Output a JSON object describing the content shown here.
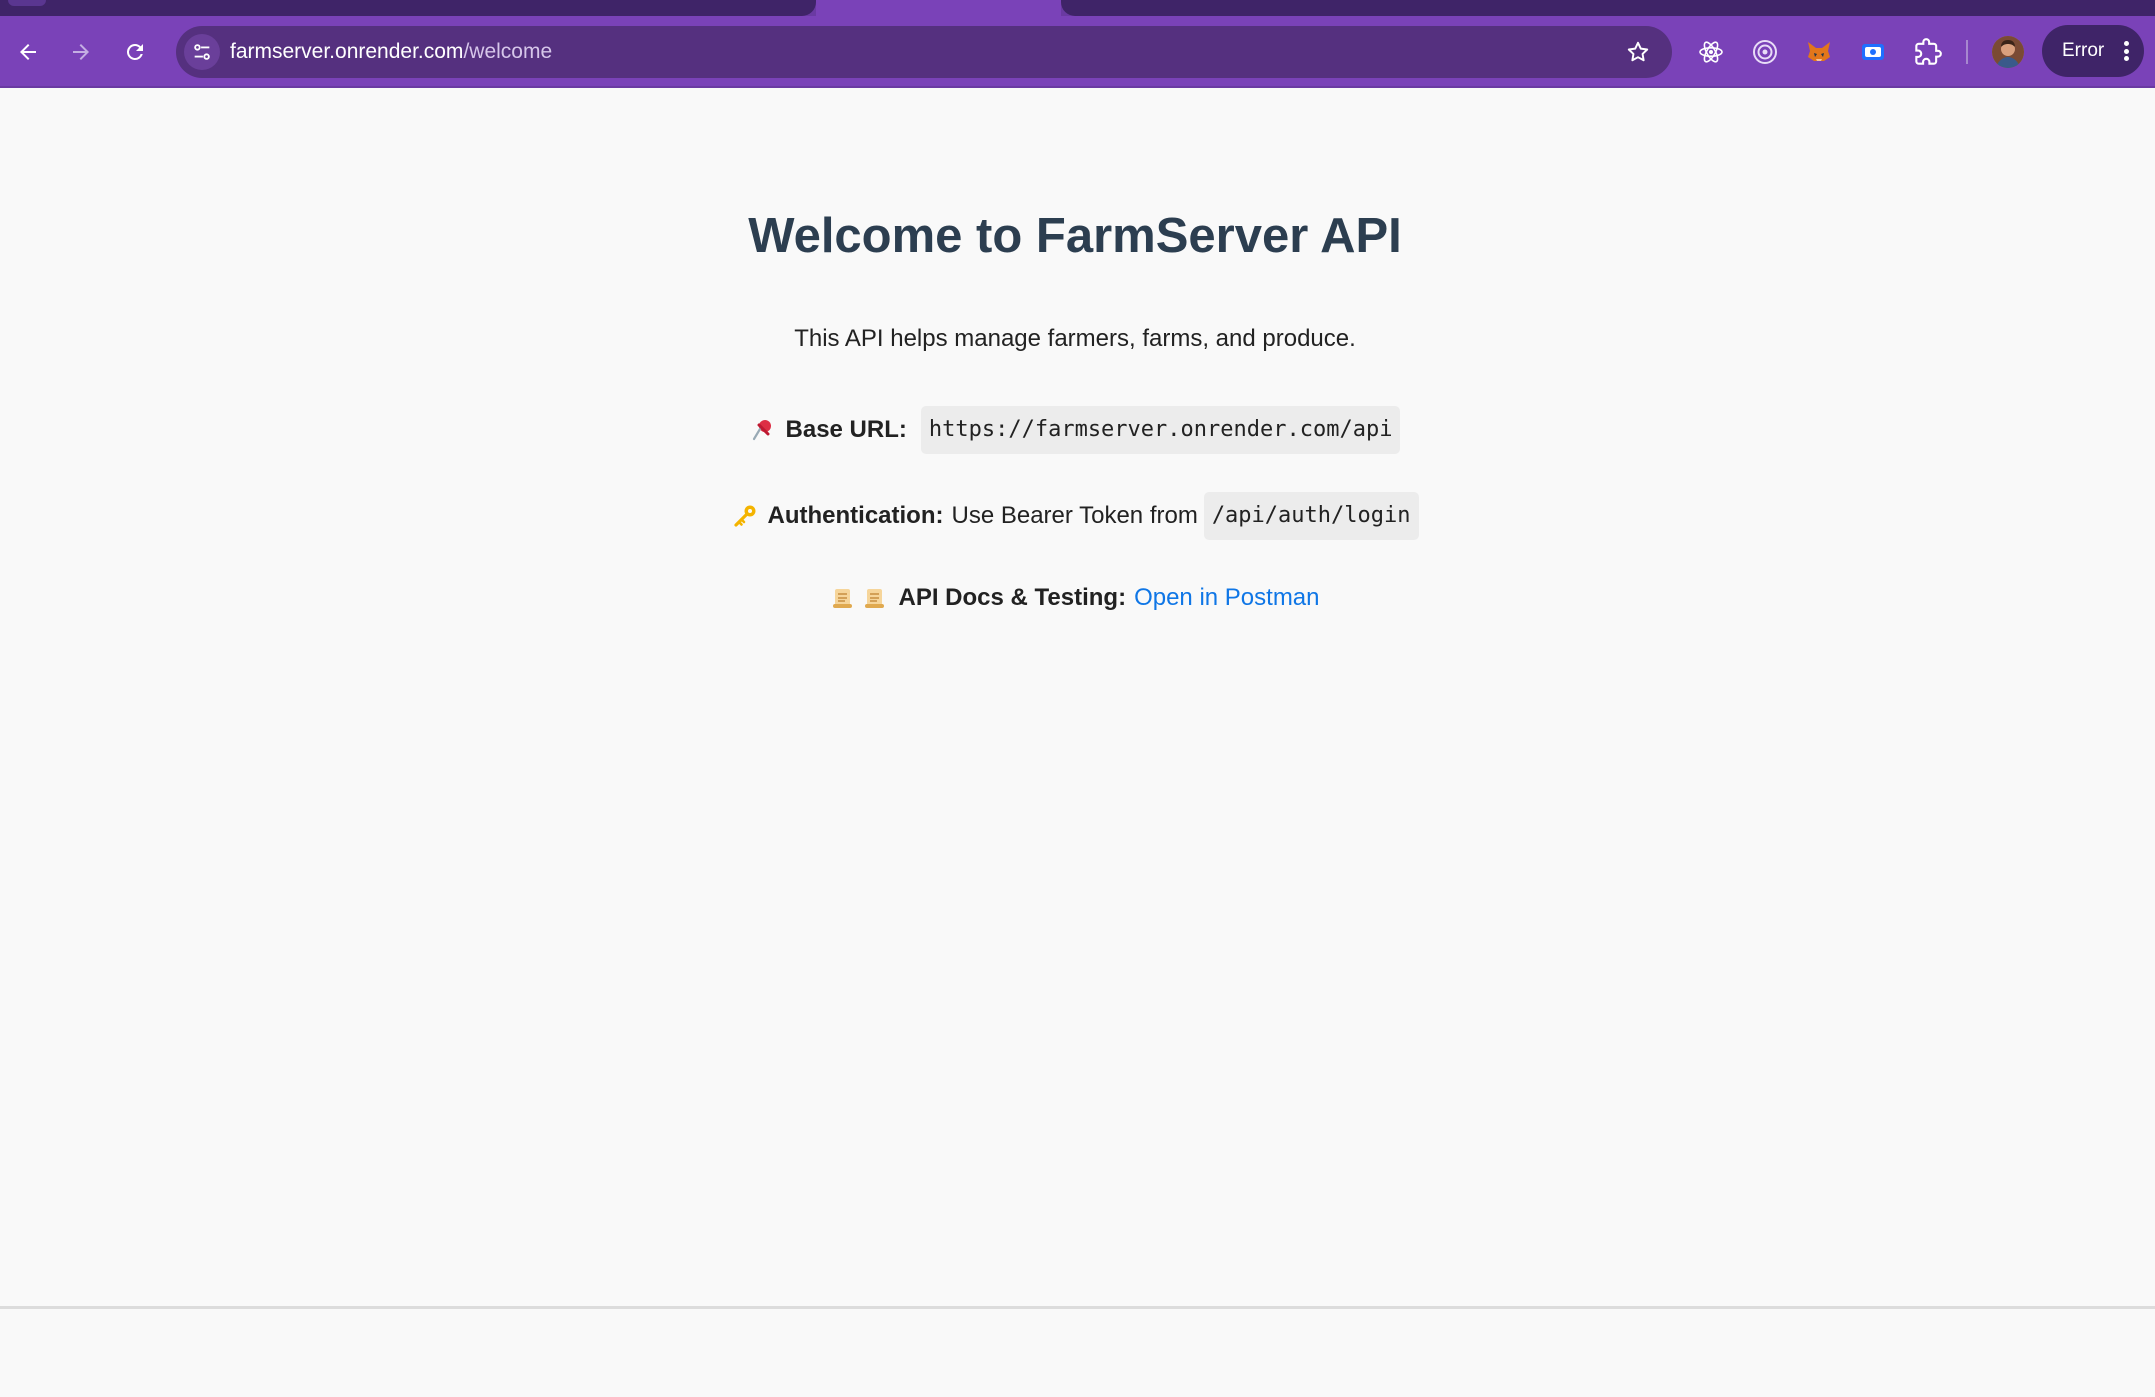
{
  "browser": {
    "address_bar": {
      "domain": "farmserver.onrender.com",
      "path": "/welcome"
    },
    "profile_status": "Error",
    "icons": {
      "back": "arrow-left-icon",
      "forward": "arrow-right-icon",
      "reload": "reload-icon",
      "site_info": "tune-icon",
      "bookmark": "star-icon",
      "extensions": [
        "react-devtools-icon",
        "target-icon",
        "metamask-fox-icon",
        "screen-capture-icon",
        "puzzle-icon"
      ],
      "menu": "kebab-icon"
    },
    "colors": {
      "frame": "#7a42b8",
      "omnibox": "#55307f"
    }
  },
  "page": {
    "title": "Welcome to FarmServer API",
    "subtitle": "This API helps manage farmers, farms, and produce.",
    "base_url": {
      "label": "Base URL:",
      "value": "https://farmserver.onrender.com/api",
      "icon": "pushpin-icon"
    },
    "authentication": {
      "label": "Authentication:",
      "text": "Use Bearer Token from",
      "endpoint": "/api/auth/login",
      "icon": "key-icon"
    },
    "docs": {
      "label": "API Docs & Testing:",
      "link_text": "Open in Postman",
      "icons": [
        "scroll-icon",
        "scroll-icon"
      ]
    },
    "colors": {
      "title": "#2c3e50",
      "link": "#0f76e6",
      "background": "#f9f9f9"
    }
  }
}
